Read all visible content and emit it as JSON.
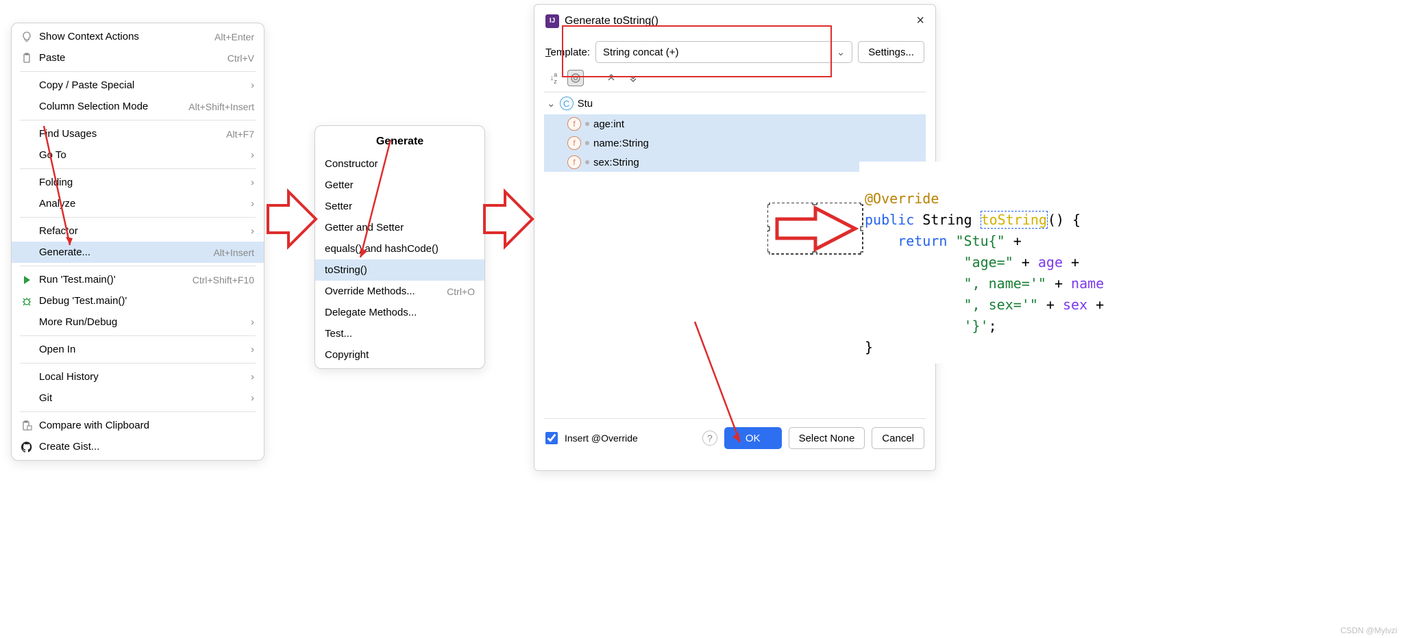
{
  "context_menu": {
    "items": [
      {
        "icon": "bulb",
        "label": "Show Context Actions",
        "shortcut": "Alt+Enter"
      },
      {
        "icon": "clipboard",
        "label": "Paste",
        "shortcut": "Ctrl+V",
        "u_start": "P"
      },
      {
        "label": "Copy / Paste Special",
        "chevron": true
      },
      {
        "label": "Column Selection Mode",
        "shortcut": "Alt+Shift+Insert",
        "u_char": "M"
      },
      {
        "label": "Find Usages",
        "shortcut": "Alt+F7",
        "u_char": "U"
      },
      {
        "label": "Go To",
        "chevron": true
      },
      {
        "label": "Folding",
        "chevron": true
      },
      {
        "label": "Analyze",
        "chevron": true,
        "u_char": "z"
      },
      {
        "label": "Refactor",
        "chevron": true,
        "u_char": "R"
      },
      {
        "label": "Generate...",
        "shortcut": "Alt+Insert",
        "selected": true
      },
      {
        "icon": "play",
        "label": "Run 'Test.main()'",
        "shortcut": "Ctrl+Shift+F10",
        "u_char": "R"
      },
      {
        "icon": "bug",
        "label": "Debug 'Test.main()'",
        "u_char": "D"
      },
      {
        "label": "More Run/Debug",
        "chevron": true
      },
      {
        "label": "Open In",
        "chevron": true
      },
      {
        "label": "Local History",
        "chevron": true,
        "u_char": "H"
      },
      {
        "label": "Git",
        "chevron": true,
        "u_char": "G"
      },
      {
        "icon": "clipcmp",
        "label": "Compare with Clipboard"
      },
      {
        "icon": "github",
        "label": "Create Gist..."
      }
    ],
    "dividers_after": [
      1,
      3,
      5,
      7,
      9,
      12,
      13,
      15
    ]
  },
  "generate_menu": {
    "title": "Generate",
    "items": [
      {
        "label": "Constructor"
      },
      {
        "label": "Getter"
      },
      {
        "label": "Setter"
      },
      {
        "label": "Getter and Setter"
      },
      {
        "label": "equals() and hashCode()"
      },
      {
        "label": "toString()",
        "selected": true
      },
      {
        "label": "Override Methods...",
        "shortcut": "Ctrl+O"
      },
      {
        "label": "Delegate Methods..."
      },
      {
        "label": "Test..."
      },
      {
        "label": "Copyright"
      }
    ]
  },
  "dialog": {
    "title": "Generate toString()",
    "template_label": "Template:",
    "template_label_u": "T",
    "template_value": "String concat (+)",
    "settings_btn": "Settings...",
    "class_name": "Stu",
    "fields": [
      {
        "name": "age",
        "type": "int"
      },
      {
        "name": "name",
        "type": "String"
      },
      {
        "name": "sex",
        "type": "String"
      }
    ],
    "insert_override": "Insert @Override",
    "ok": "OK",
    "select_none": "Select None",
    "cancel": "Cancel"
  },
  "code": {
    "l1_anno": "@Override",
    "l2_pub": "public",
    "l2_str": "String",
    "l2_fn": "toString",
    "l2_rest": "() {",
    "l3_ret": "return",
    "l3_s": "\"Stu{\"",
    "l3_p": " +",
    "l4_s": "\"age=\"",
    "l4_p": " + ",
    "l4_v": "age",
    "l4_e": " +",
    "l5_s": "\", name='\"",
    "l5_p": " + ",
    "l5_v": "name",
    "l6_s": "\", sex='\"",
    "l6_p": " + ",
    "l6_v": "sex",
    "l6_e": " +",
    "l7_s": "'}'",
    "l7_e": ";",
    "l8": "}"
  },
  "watermark": "CSDN @Mylvzi"
}
